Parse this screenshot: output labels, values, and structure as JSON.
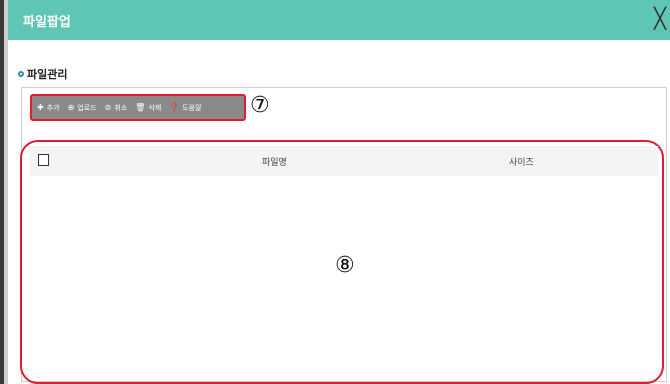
{
  "window": {
    "title": "파일팝업",
    "close_glyph": "╳"
  },
  "section": {
    "title": "파일관리"
  },
  "toolbar": {
    "buttons": [
      {
        "icon": "plus-icon",
        "glyph": "✚",
        "label": "추가"
      },
      {
        "icon": "upload-icon",
        "glyph": "⊕",
        "label": "업로드"
      },
      {
        "icon": "cancel-icon",
        "glyph": "⊘",
        "label": "취소"
      },
      {
        "icon": "trash-icon",
        "glyph": "🗑",
        "label": "삭제"
      },
      {
        "icon": "help-icon",
        "glyph": "❓",
        "label": "도움말"
      }
    ]
  },
  "table": {
    "columns": [
      "파일명",
      "사이즈"
    ],
    "rows": []
  },
  "callouts": {
    "toolbar": "⑦",
    "table": "⑧"
  },
  "colors": {
    "titlebar": "#5fc6b4",
    "toolbar": "#8a8a8a",
    "highlight": "#e21c2c"
  }
}
